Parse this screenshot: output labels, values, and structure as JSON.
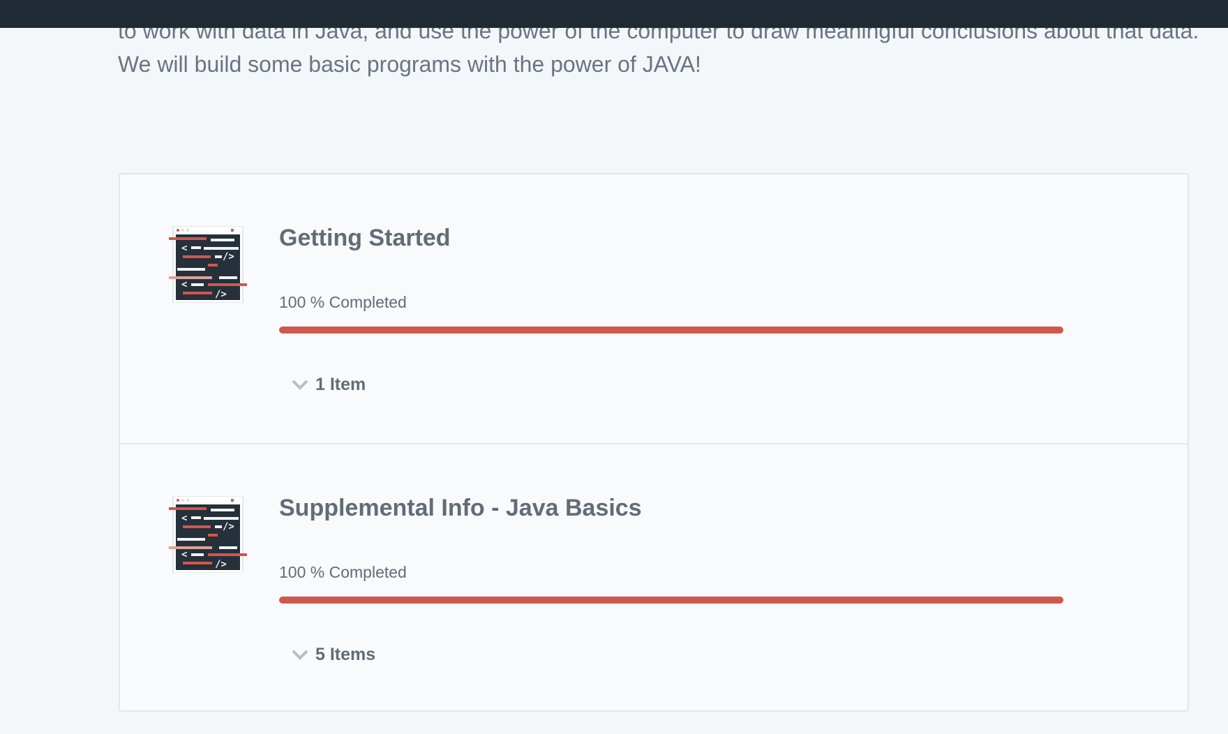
{
  "intro": {
    "line1": "to work with data in Java, and use the power of the computer to draw meaningful conclusions about that data.",
    "line2": "We will build some basic programs with the power of JAVA!"
  },
  "colors": {
    "accent": "#d0574c",
    "topbar": "#1f2a35",
    "text": "#626c77"
  },
  "sections": [
    {
      "title": "Getting Started",
      "progress_percent": 100,
      "progress_text": "100 % Completed",
      "items_label": "1 Item",
      "icon": "code-editor-icon",
      "toggle_icon": "chevron-down-icon"
    },
    {
      "title": "Supplemental Info - Java Basics",
      "progress_percent": 100,
      "progress_text": "100 % Completed",
      "items_label": "5 Items",
      "icon": "code-editor-icon",
      "toggle_icon": "chevron-down-icon"
    }
  ]
}
